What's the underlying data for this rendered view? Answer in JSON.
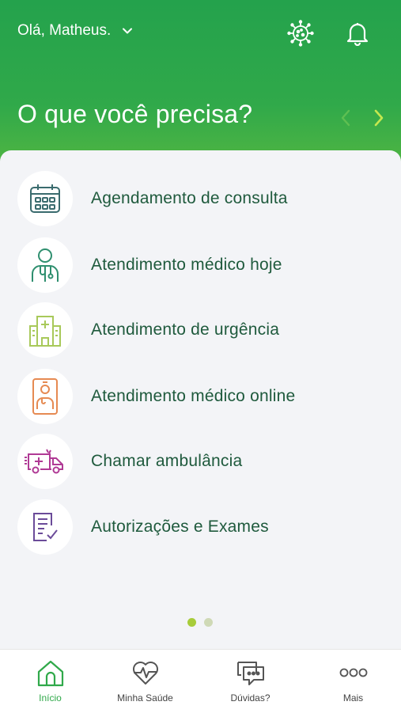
{
  "header": {
    "greeting": "Olá, Matheus.",
    "title": "O que você precisa?",
    "icons": [
      "virus-icon",
      "bell-icon",
      "chevron-left-icon",
      "chevron-right-icon"
    ]
  },
  "menu": {
    "items": [
      {
        "label": "Agendamento de consulta",
        "icon": "calendar-icon"
      },
      {
        "label": "Atendimento médico hoje",
        "icon": "doctor-icon"
      },
      {
        "label": "Atendimento de urgência",
        "icon": "hospital-icon"
      },
      {
        "label": "Atendimento médico online",
        "icon": "phone-doctor-icon"
      },
      {
        "label": "Chamar ambulância",
        "icon": "ambulance-icon"
      },
      {
        "label": "Autorizações e Exames",
        "icon": "document-check-icon"
      }
    ]
  },
  "pagination": {
    "pages": 2,
    "current": 1
  },
  "bottom_nav": {
    "items": [
      {
        "label": "Início",
        "icon": "home-icon",
        "active": true
      },
      {
        "label": "Minha Saúde",
        "icon": "heart-pulse-icon",
        "active": false
      },
      {
        "label": "Dúvidas?",
        "icon": "chat-icon",
        "active": false
      },
      {
        "label": "Mais",
        "icon": "more-icon",
        "active": false
      }
    ]
  },
  "colors": {
    "header_top": "#24a24c",
    "header_bottom": "#5cba3f",
    "accent": "#30a94a",
    "text_dark_green": "#1f5a3d",
    "card_bg": "#f3f4f7"
  }
}
